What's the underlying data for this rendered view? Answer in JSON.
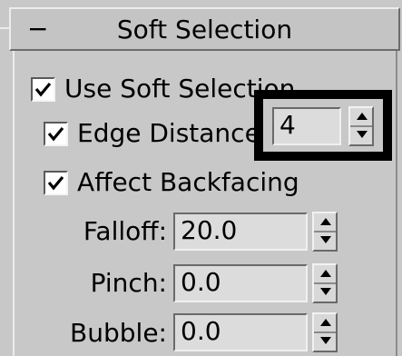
{
  "rollout": {
    "collapse_symbol": "−",
    "title": "Soft Selection"
  },
  "options": {
    "use_soft_selection": {
      "label": "Use Soft Selection",
      "checked": true
    },
    "edge_distance": {
      "label": "Edge Distance",
      "checked": true,
      "value": "4"
    },
    "affect_backfacing": {
      "label": "Affect Backfacing",
      "checked": true
    }
  },
  "params": {
    "falloff": {
      "label": "Falloff:",
      "value": "20.0"
    },
    "pinch": {
      "label": "Pinch:",
      "value": "0.0"
    },
    "bubble": {
      "label": "Bubble:",
      "value": "0.0"
    }
  },
  "icons": {
    "check": "check-icon",
    "spin_up": "spin-up-icon",
    "spin_down": "spin-down-icon"
  }
}
